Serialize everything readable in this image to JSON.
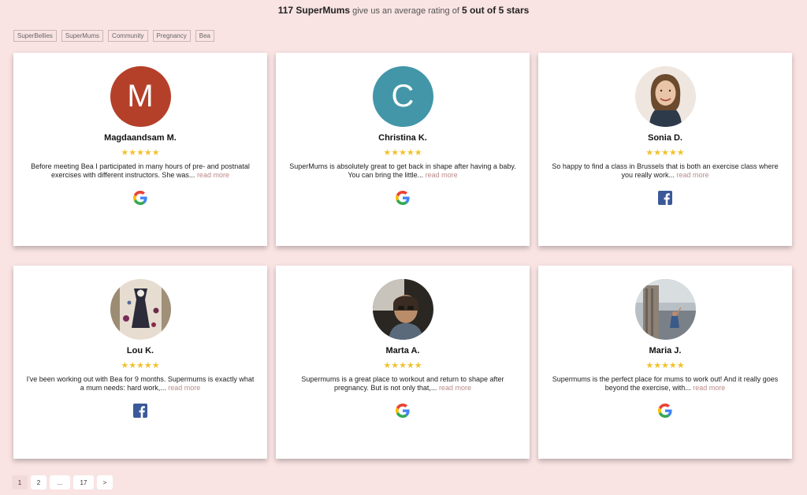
{
  "summary": {
    "count_label": "117 SuperMums",
    "middle": " give us an average rating of ",
    "rating_label": "5 out of 5 stars"
  },
  "tags": [
    "SuperBellies",
    "SuperMums",
    "Community",
    "Pregnancy",
    "Bea"
  ],
  "reviews": [
    {
      "name": "Magdaandsam M.",
      "avatar_letter": "M",
      "avatar_color": "#b5402a",
      "stars": "★★★★★",
      "text": "Before meeting Bea I participated in many hours of pre- and postnatal exercises with different instructors. She was...",
      "read_more": " read more",
      "source": "google-icon"
    },
    {
      "name": "Christina K.",
      "avatar_letter": "C",
      "avatar_color": "#4296a8",
      "stars": "★★★★★",
      "text": "SuperMums is absolutely great to get back in shape after having a baby. You can bring the little...",
      "read_more": " read more",
      "source": "google-icon"
    },
    {
      "name": "Sonia D.",
      "avatar_letter": "",
      "avatar_color": "#e8ddd5",
      "stars": "★★★★★",
      "text": "So happy to find a class in Brussels that is both an exercise class where you really work...",
      "read_more": " read more",
      "source": "facebook-icon"
    },
    {
      "name": "Lou K.",
      "avatar_letter": "",
      "avatar_color": "#ddd5c8",
      "stars": "★★★★★",
      "text": "I've been working out with Bea for 9 months. Supermums is exactly what a mum needs: hard work,...",
      "read_more": " read more",
      "source": "facebook-icon"
    },
    {
      "name": "Marta A.",
      "avatar_letter": "",
      "avatar_color": "#3a3530",
      "stars": "★★★★★",
      "text": "Supermums is a great place to workout and return to shape after pregnancy. But is not only that,...",
      "read_more": " read more",
      "source": "google-icon"
    },
    {
      "name": "Maria J.",
      "avatar_letter": "",
      "avatar_color": "#9aa0a4",
      "stars": "★★★★★",
      "text": "Supermums is the perfect place for mums to work out! And it really goes beyond the exercise, with...",
      "read_more": " read more",
      "source": "google-icon"
    }
  ],
  "pagination": {
    "pages": [
      "1",
      "2",
      "...",
      "17",
      ">"
    ],
    "current": "1"
  },
  "colors": {
    "background": "#f9e3e3",
    "star": "#f2c230",
    "read_more": "#b98a8a",
    "facebook": "#3b5998"
  }
}
